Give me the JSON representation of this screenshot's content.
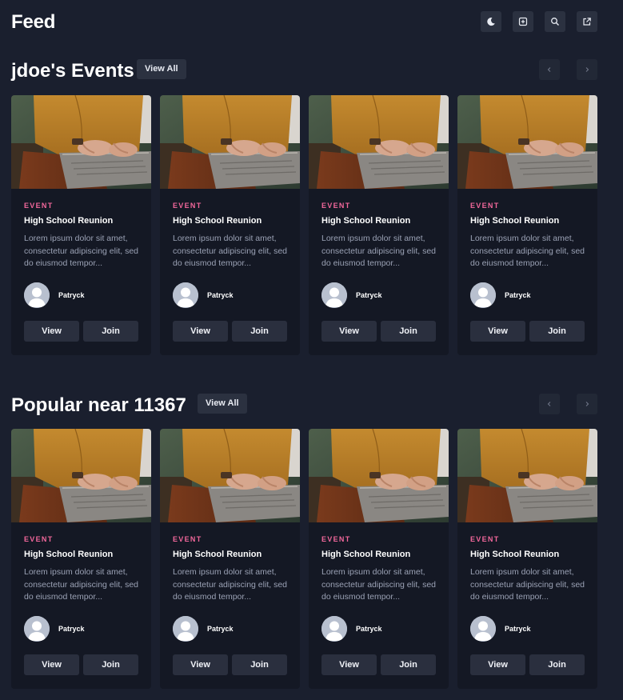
{
  "header": {
    "title": "Feed",
    "actions": [
      {
        "icon": "moon-icon",
        "label": "theme toggle"
      },
      {
        "icon": "plus-square-icon",
        "label": "create"
      },
      {
        "icon": "search-icon",
        "label": "search"
      },
      {
        "icon": "external-link-icon",
        "label": "open external"
      }
    ]
  },
  "sections": [
    {
      "title": "jdoe's Events",
      "view_all_label": "View All",
      "prev_label": "‹",
      "next_label": "›",
      "cards": [
        {
          "category": "EVENT",
          "title": "High School Reunion",
          "description": "Lorem ipsum dolor sit amet, consectetur adipiscing elit, sed do eiusmod tempor...",
          "author": "Patryck",
          "view_label": "View",
          "join_label": "Join"
        },
        {
          "category": "EVENT",
          "title": "High School Reunion",
          "description": "Lorem ipsum dolor sit amet, consectetur adipiscing elit, sed do eiusmod tempor...",
          "author": "Patryck",
          "view_label": "View",
          "join_label": "Join"
        },
        {
          "category": "EVENT",
          "title": "High School Reunion",
          "description": "Lorem ipsum dolor sit amet, consectetur adipiscing elit, sed do eiusmod tempor...",
          "author": "Patryck",
          "view_label": "View",
          "join_label": "Join"
        },
        {
          "category": "EVENT",
          "title": "High School Reunion",
          "description": "Lorem ipsum dolor sit amet, consectetur adipiscing elit, sed do eiusmod tempor...",
          "author": "Patryck",
          "view_label": "View",
          "join_label": "Join"
        }
      ]
    },
    {
      "title": "Popular near 11367",
      "view_all_label": "View All",
      "prev_label": "‹",
      "next_label": "›",
      "cards": [
        {
          "category": "EVENT",
          "title": "High School Reunion",
          "description": "Lorem ipsum dolor sit amet, consectetur adipiscing elit, sed do eiusmod tempor...",
          "author": "Patryck",
          "view_label": "View",
          "join_label": "Join"
        },
        {
          "category": "EVENT",
          "title": "High School Reunion",
          "description": "Lorem ipsum dolor sit amet, consectetur adipiscing elit, sed do eiusmod tempor...",
          "author": "Patryck",
          "view_label": "View",
          "join_label": "Join"
        },
        {
          "category": "EVENT",
          "title": "High School Reunion",
          "description": "Lorem ipsum dolor sit amet, consectetur adipiscing elit, sed do eiusmod tempor...",
          "author": "Patryck",
          "view_label": "View",
          "join_label": "Join"
        },
        {
          "category": "EVENT",
          "title": "High School Reunion",
          "description": "Lorem ipsum dolor sit amet, consectetur adipiscing elit, sed do eiusmod tempor...",
          "author": "Patryck",
          "view_label": "View",
          "join_label": "Join"
        }
      ]
    }
  ],
  "colors": {
    "background": "#1a1f2e",
    "card": "#141824",
    "button": "#2a2f3e",
    "accent": "#f2679b"
  }
}
